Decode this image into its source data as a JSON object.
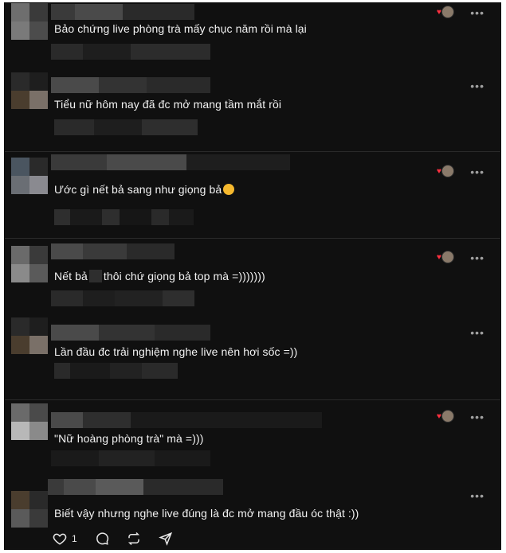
{
  "comments": [
    {
      "text": "Bảo chứng live phòng trà mấy chục năm rồi mà lại"
    },
    {
      "text": "Tiểu nữ hôm nay đã đc mở mang tầm mắt rồi"
    },
    {
      "text": "Ước gì nết bả sang như giọng bả"
    },
    {
      "text_before": "Nết bả",
      "text_after": "thôi chứ giọng bả top mà =)))))))"
    },
    {
      "text": "Lần đầu đc trải nghiệm nghe live nên hơi sốc =))"
    },
    {
      "text": "\"Nữ hoàng phòng trà\" mà =)))"
    },
    {
      "text": "Biết vậy nhưng nghe live đúng là đc mở mang đầu óc thật :))"
    }
  ],
  "more_label": "•••",
  "footer": {
    "like_count": "1"
  },
  "colors": {
    "background": "#101010",
    "text": "#f2f2f2",
    "heart": "#ff3040",
    "muted": "#a0a0a0"
  },
  "icons": [
    "heart-icon",
    "comment-icon",
    "repost-icon",
    "share-icon",
    "more-icon"
  ]
}
